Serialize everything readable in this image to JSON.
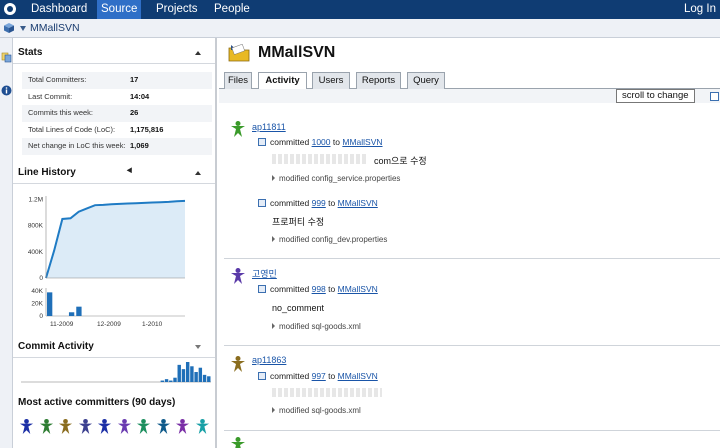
{
  "nav": {
    "items": [
      "Dashboard",
      "Source",
      "Projects",
      "People"
    ],
    "active": "Source",
    "login": "Log In"
  },
  "breadcrumb": {
    "project": "MMallSVN"
  },
  "sidebar": {
    "stats": {
      "title": "Stats",
      "rows": [
        {
          "label": "Total Committers:",
          "value": "17"
        },
        {
          "label": "Last Commit:",
          "value": "14:04"
        },
        {
          "label": "Commits this week:",
          "value": "26"
        },
        {
          "label": "Total Lines of Code (LoC):",
          "value": "1,175,816"
        },
        {
          "label": "Net change in LoC this week:",
          "value": "1,069"
        }
      ]
    },
    "line_history": {
      "title": "Line History"
    },
    "commit_activity": {
      "title": "Commit Activity"
    },
    "committers": {
      "title": "Most active committers (90 days)"
    }
  },
  "chart_data": [
    {
      "type": "area",
      "title": "Line History",
      "ylabel": "",
      "xlabel": "",
      "y_ticks": [
        "1.2M",
        "800K",
        "400K",
        "0"
      ],
      "ylim": [
        0,
        1250000
      ],
      "x_tick_labels": [
        "11-2009",
        "12-2009",
        "1-2010"
      ],
      "x": [
        0,
        1,
        2,
        3,
        4,
        5,
        6,
        7,
        8,
        9,
        10,
        11,
        12,
        13,
        14,
        15,
        16,
        17
      ],
      "values": [
        0,
        420000,
        900000,
        910000,
        1010000,
        1060000,
        1110000,
        1115000,
        1125000,
        1130000,
        1135000,
        1140000,
        1145000,
        1150000,
        1155000,
        1160000,
        1170000,
        1175816
      ]
    },
    {
      "type": "bar",
      "title": "",
      "y_ticks": [
        "40K",
        "20K",
        "0"
      ],
      "ylim": [
        0,
        45000
      ],
      "values": [
        38000,
        0,
        0,
        6000,
        15000,
        0,
        0,
        0,
        0,
        0,
        0,
        0,
        0,
        0,
        0,
        0,
        0,
        0,
        0
      ]
    },
    {
      "type": "bar",
      "title": "Commit Activity",
      "values": [
        0,
        0,
        0,
        0,
        0,
        0,
        0,
        0,
        0,
        0,
        0,
        0,
        0,
        0,
        0,
        0,
        0,
        0,
        0,
        0,
        0,
        0,
        0,
        0,
        0,
        0,
        0,
        0,
        0,
        0,
        0,
        0,
        0,
        1,
        2,
        1,
        3,
        12,
        9,
        14,
        11,
        7,
        10,
        5,
        4
      ]
    }
  ],
  "committer_avatars": [
    "#1c2fa6",
    "#2e7d32",
    "#8a6d1f",
    "#3b3f8f",
    "#1c2fa6",
    "#6a3bb0",
    "#1c8f5e",
    "#0f5a8a",
    "#7a2fa6",
    "#18a0a6"
  ],
  "main": {
    "title": "MMallSVN",
    "tabs": [
      "Files",
      "Activity",
      "Users",
      "Reports",
      "Query"
    ],
    "active_tab": "Activity",
    "scroll_button": "scroll to change",
    "entries": [
      {
        "author": "ap11811",
        "avatar_color": "#3a9a2a",
        "commits": [
          {
            "revision": "1000",
            "target": "MMallSVN",
            "message": "com으로 수정",
            "modified": "modified config_service.properties"
          },
          {
            "revision": "999",
            "target": "MMallSVN",
            "message": "프로퍼티 수정",
            "modified": "modified config_dev.properties"
          }
        ]
      },
      {
        "author": "고영민",
        "avatar_color": "#5a3aa8",
        "commits": [
          {
            "revision": "998",
            "target": "MMallSVN",
            "message": "no_comment",
            "modified": "modified sql-goods.xml"
          }
        ]
      },
      {
        "author": "ap11863",
        "avatar_color": "#8a6d1f",
        "commits": [
          {
            "revision": "997",
            "target": "MMallSVN",
            "message": "",
            "modified": "modified sql-goods.xml"
          }
        ]
      }
    ],
    "committed_word": "committed",
    "to_word": "to"
  }
}
